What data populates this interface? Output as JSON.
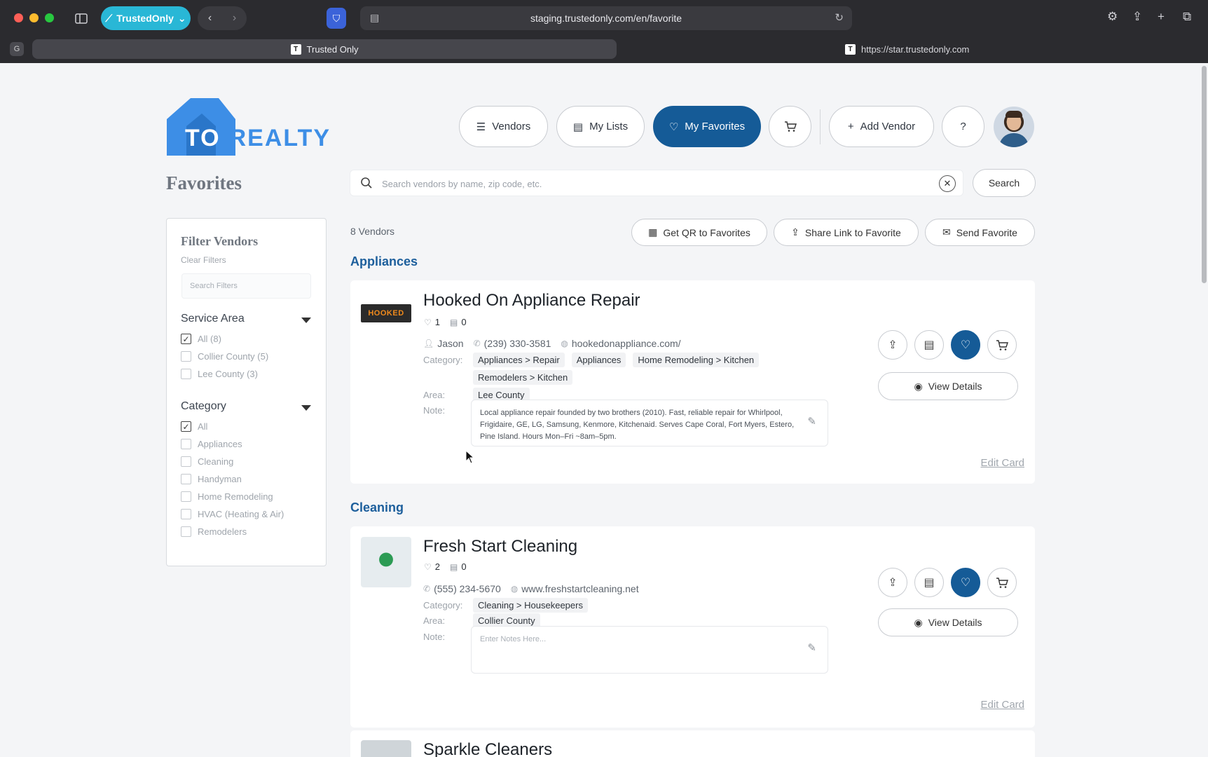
{
  "browser": {
    "profile_label": "TrustedOnly",
    "url": "staging.trustedonly.com/en/favorite",
    "tabs": [
      {
        "label": "Trusted Only",
        "active": true
      },
      {
        "label": "https://star.trustedonly.com",
        "active": false
      }
    ],
    "tab_group_label": "G"
  },
  "logo": {
    "to": "TO",
    "realty": "REALTY"
  },
  "header": {
    "page_title": "Favorites",
    "nav": {
      "vendors": "Vendors",
      "my_lists": "My Lists",
      "my_favorites": "My Favorites",
      "add_vendor": "Add Vendor",
      "help": "?"
    }
  },
  "search": {
    "placeholder": "Search vendors by name, zip code, etc.",
    "value": "",
    "button_label": "Search"
  },
  "filters": {
    "title": "Filter Vendors",
    "clear_label": "Clear Filters",
    "search_placeholder": "Search Filters",
    "service_area": {
      "label": "Service Area",
      "options": [
        {
          "label": "All (8)",
          "checked": true
        },
        {
          "label": "Collier County (5)",
          "checked": false
        },
        {
          "label": "Lee County (3)",
          "checked": false
        }
      ]
    },
    "category": {
      "label": "Category",
      "options": [
        {
          "label": "All",
          "checked": true
        },
        {
          "label": "Appliances",
          "checked": false
        },
        {
          "label": "Cleaning",
          "checked": false
        },
        {
          "label": "Handyman",
          "checked": false
        },
        {
          "label": "Home Remodeling",
          "checked": false
        },
        {
          "label": "HVAC (Heating & Air)",
          "checked": false
        },
        {
          "label": "Remodelers",
          "checked": false
        }
      ]
    }
  },
  "list": {
    "vendor_count": "8 Vendors",
    "actions": {
      "qr": "Get QR to Favorites",
      "share": "Share Link to Favorite",
      "send": "Send Favorite"
    },
    "groups": [
      {
        "category": "Appliances",
        "vendors": [
          {
            "name": "Hooked On Appliance Repair",
            "logo_text": "HOOKED",
            "likes": "1",
            "lists": "0",
            "contact": "Jason",
            "phone": "(239) 330-3581",
            "website": "hookedonappliance.com/",
            "category_label": "Category:",
            "categories": [
              "Appliances > Repair",
              "Appliances",
              "Home Remodeling > Kitchen",
              "Remodelers > Kitchen"
            ],
            "area_label": "Area:",
            "area": "Lee County",
            "note_label": "Note:",
            "note": "Local appliance repair founded by two brothers (2010). Fast, reliable repair for Whirlpool, Frigidaire, GE, LG, Samsung, Kenmore, Kitchenaid. Serves Cape Coral, Fort Myers, Estero, Pine Island. Hours Mon–Fri ~8am–5pm.",
            "view_details": "View Details",
            "edit_card": "Edit Card"
          }
        ]
      },
      {
        "category": "Cleaning",
        "vendors": [
          {
            "name": "Fresh Start Cleaning",
            "likes": "2",
            "lists": "0",
            "phone": "(555) 234-5670",
            "website": "www.freshstartcleaning.net",
            "category_label": "Category:",
            "categories": [
              "Cleaning > Housekeepers"
            ],
            "area_label": "Area:",
            "area": "Collier County",
            "note_label": "Note:",
            "note_placeholder": "Enter Notes Here...",
            "view_details": "View Details",
            "edit_card": "Edit Card"
          },
          {
            "name": "Sparkle Cleaners"
          }
        ]
      }
    ]
  },
  "colors": {
    "primary": "#155b97",
    "heading_blue": "#1d5f9c",
    "logo_blue": "#3d8ee6",
    "browser_accent": "#29b7d6"
  },
  "icons": [
    "sidebar-toggle-icon",
    "back-icon",
    "forward-icon",
    "shield-icon",
    "reader-icon",
    "reload-icon",
    "settings-icon",
    "share-icon",
    "new-tab-icon",
    "tabs-overview-icon",
    "list-icon",
    "document-icon",
    "heart-icon",
    "cart-icon",
    "plus-icon",
    "help-icon",
    "search-icon",
    "clear-icon",
    "qr-icon",
    "mail-icon",
    "eye-icon",
    "pencil-icon",
    "user-icon",
    "phone-icon",
    "globe-icon"
  ]
}
